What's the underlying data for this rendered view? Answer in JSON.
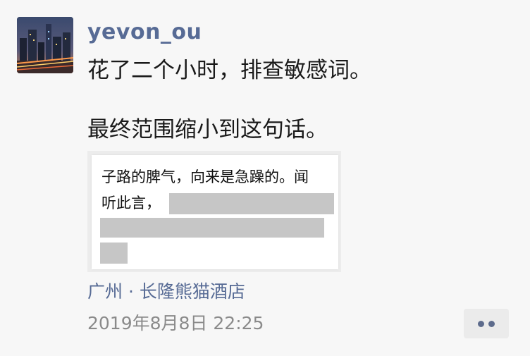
{
  "post": {
    "username": "yevon_ou",
    "text_lines": [
      "花了二个小时，排查敏感词。",
      "最终范围缩小到这句话。"
    ],
    "attachment": {
      "quote_lines": [
        "子路的脾气，向来是急躁的。闻",
        "听此言，"
      ],
      "redacted_color": "#c6c6c6"
    },
    "location": "广州 · 长隆熊猫酒店",
    "timestamp": "2019年8月8日 22:25",
    "more_button_icon": "more-dots-icon"
  },
  "colors": {
    "name_link": "#576b95",
    "text": "#1a1a1a",
    "meta_gray": "#8a8a8a",
    "background": "#f7f7f7"
  }
}
